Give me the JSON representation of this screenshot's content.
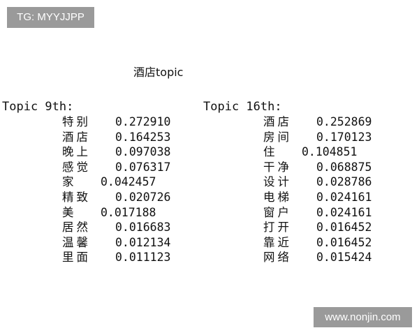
{
  "watermark_top": "TG: MYYJJPP",
  "watermark_bottom": "www.nonjin.com",
  "title": "酒店topic",
  "topics": [
    {
      "heading": "Topic 9th:",
      "rows": [
        {
          "word": "特别",
          "value": "0.272910"
        },
        {
          "word": "酒店",
          "value": "0.164253"
        },
        {
          "word": "晚上",
          "value": "0.097038"
        },
        {
          "word": "感觉",
          "value": "0.076317"
        },
        {
          "word": "家",
          "value": "0.042457"
        },
        {
          "word": "精致",
          "value": "0.020726"
        },
        {
          "word": "美",
          "value": "0.017188"
        },
        {
          "word": "居然",
          "value": "0.016683"
        },
        {
          "word": "温馨",
          "value": "0.012134"
        },
        {
          "word": "里面",
          "value": "0.011123"
        }
      ]
    },
    {
      "heading": "Topic 16th:",
      "rows": [
        {
          "word": "酒店",
          "value": "0.252869"
        },
        {
          "word": "房间",
          "value": "0.170123"
        },
        {
          "word": "住",
          "value": "0.104851"
        },
        {
          "word": "干净",
          "value": "0.068875"
        },
        {
          "word": "设计",
          "value": "0.028786"
        },
        {
          "word": "电梯",
          "value": "0.024161"
        },
        {
          "word": "窗户",
          "value": "0.024161"
        },
        {
          "word": "打开",
          "value": "0.016452"
        },
        {
          "word": "靠近",
          "value": "0.016452"
        },
        {
          "word": "网络",
          "value": "0.015424"
        }
      ]
    }
  ]
}
